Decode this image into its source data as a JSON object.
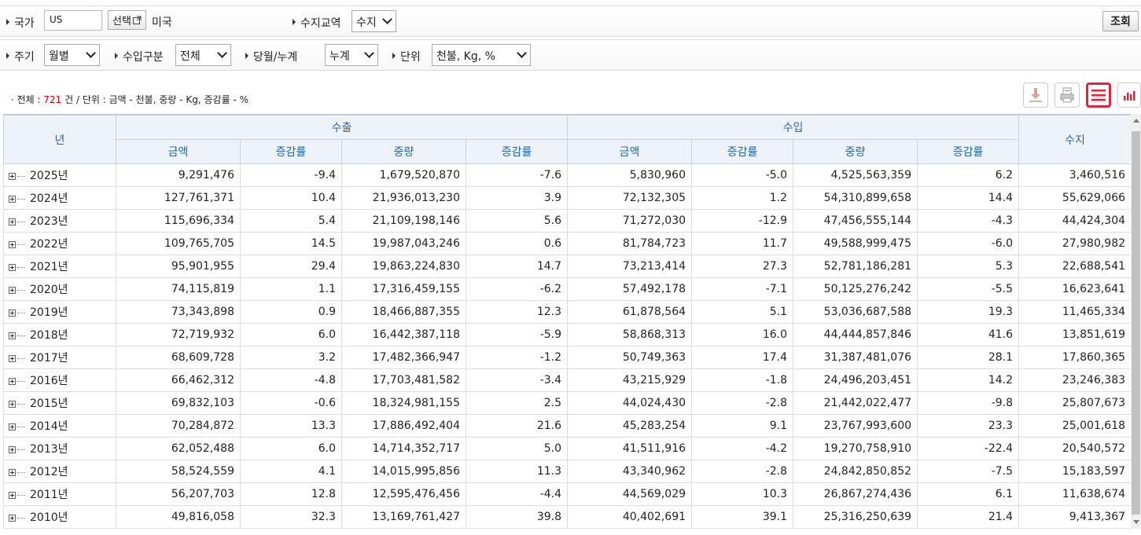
{
  "filters": {
    "country_label": "국가",
    "country_code": "US",
    "select_button": "선택",
    "country_name": "미국",
    "trade_label": "수지교역",
    "trade_value": "수지",
    "search_button": "조회",
    "period_label": "주기",
    "period_value": "월별",
    "import_type_label": "수입구분",
    "import_type_value": "전체",
    "cumulative_label": "당월/누계",
    "cumulative_value": "누계",
    "unit_label": "단위",
    "unit_value": "천불, Kg, %"
  },
  "summary": {
    "prefix": "· 전체 :",
    "count": "721",
    "suffix": "건 / 단위 : 금액 - 천불, 중량 - Kg, 증감률 - %"
  },
  "toolbar": {
    "download_icon": "download-icon",
    "print_icon": "print-icon",
    "table_icon": "list-icon",
    "chart_icon": "bar-chart-icon",
    "active_color": "#e8213a"
  },
  "table": {
    "header_year": "년",
    "group_export": "수출",
    "group_import": "수입",
    "header_balance": "수지",
    "sub": [
      "금액",
      "증감률",
      "중량",
      "증감률",
      "금액",
      "증감률",
      "중량",
      "증감률"
    ],
    "rows": [
      [
        "2025년",
        "9,291,476",
        "-9.4",
        "1,679,520,870",
        "-7.6",
        "5,830,960",
        "-5.0",
        "4,525,563,359",
        "6.2",
        "3,460,516"
      ],
      [
        "2024년",
        "127,761,371",
        "10.4",
        "21,936,013,230",
        "3.9",
        "72,132,305",
        "1.2",
        "54,310,899,658",
        "14.4",
        "55,629,066"
      ],
      [
        "2023년",
        "115,696,334",
        "5.4",
        "21,109,198,146",
        "5.6",
        "71,272,030",
        "-12.9",
        "47,456,555,144",
        "-4.3",
        "44,424,304"
      ],
      [
        "2022년",
        "109,765,705",
        "14.5",
        "19,987,043,246",
        "0.6",
        "81,784,723",
        "11.7",
        "49,588,999,475",
        "-6.0",
        "27,980,982"
      ],
      [
        "2021년",
        "95,901,955",
        "29.4",
        "19,863,224,830",
        "14.7",
        "73,213,414",
        "27.3",
        "52,781,186,281",
        "5.3",
        "22,688,541"
      ],
      [
        "2020년",
        "74,115,819",
        "1.1",
        "17,316,459,155",
        "-6.2",
        "57,492,178",
        "-7.1",
        "50,125,276,242",
        "-5.5",
        "16,623,641"
      ],
      [
        "2019년",
        "73,343,898",
        "0.9",
        "18,466,887,355",
        "12.3",
        "61,878,564",
        "5.1",
        "53,036,687,588",
        "19.3",
        "11,465,334"
      ],
      [
        "2018년",
        "72,719,932",
        "6.0",
        "16,442,387,118",
        "-5.9",
        "58,868,313",
        "16.0",
        "44,444,857,846",
        "41.6",
        "13,851,619"
      ],
      [
        "2017년",
        "68,609,728",
        "3.2",
        "17,482,366,947",
        "-1.2",
        "50,749,363",
        "17.4",
        "31,387,481,076",
        "28.1",
        "17,860,365"
      ],
      [
        "2016년",
        "66,462,312",
        "-4.8",
        "17,703,481,582",
        "-3.4",
        "43,215,929",
        "-1.8",
        "24,496,203,451",
        "14.2",
        "23,246,383"
      ],
      [
        "2015년",
        "69,832,103",
        "-0.6",
        "18,324,981,155",
        "2.5",
        "44,024,430",
        "-2.8",
        "21,442,022,477",
        "-9.8",
        "25,807,673"
      ],
      [
        "2014년",
        "70,284,872",
        "13.3",
        "17,886,492,404",
        "21.6",
        "45,283,254",
        "9.1",
        "23,767,993,600",
        "23.3",
        "25,001,618"
      ],
      [
        "2013년",
        "62,052,488",
        "6.0",
        "14,714,352,717",
        "5.0",
        "41,511,916",
        "-4.2",
        "19,270,758,910",
        "-22.4",
        "20,540,572"
      ],
      [
        "2012년",
        "58,524,559",
        "4.1",
        "14,015,995,856",
        "11.3",
        "43,340,962",
        "-2.8",
        "24,842,850,852",
        "-7.5",
        "15,183,597"
      ],
      [
        "2011년",
        "56,207,703",
        "12.8",
        "12,595,476,456",
        "-4.4",
        "44,569,029",
        "10.3",
        "26,867,274,436",
        "6.1",
        "11,638,674"
      ],
      [
        "2010년",
        "49,816,058",
        "32.3",
        "13,169,761,427",
        "39.8",
        "40,402,691",
        "39.1",
        "25,316,250,639",
        "21.4",
        "9,413,367"
      ]
    ]
  }
}
